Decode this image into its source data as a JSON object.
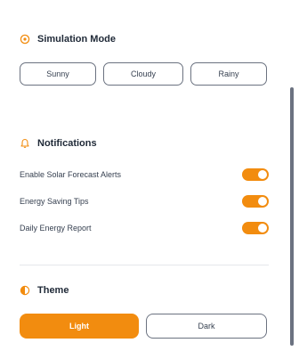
{
  "simulation_mode": {
    "title": "Simulation Mode",
    "icon": "target-icon",
    "options": [
      {
        "label": "Sunny"
      },
      {
        "label": "Cloudy"
      },
      {
        "label": "Rainy"
      }
    ]
  },
  "notifications": {
    "title": "Notifications",
    "icon": "bell-icon",
    "items": [
      {
        "label": "Enable Solar Forecast Alerts",
        "enabled": true
      },
      {
        "label": "Energy Saving Tips",
        "enabled": true
      },
      {
        "label": "Daily Energy Report",
        "enabled": true
      }
    ]
  },
  "theme": {
    "title": "Theme",
    "icon": "half-circle-icon",
    "options": [
      {
        "label": "Light",
        "selected": true
      },
      {
        "label": "Dark",
        "selected": false
      }
    ]
  },
  "colors": {
    "accent": "#f28c0f",
    "border": "#6b7280",
    "text": "#1f2937"
  }
}
